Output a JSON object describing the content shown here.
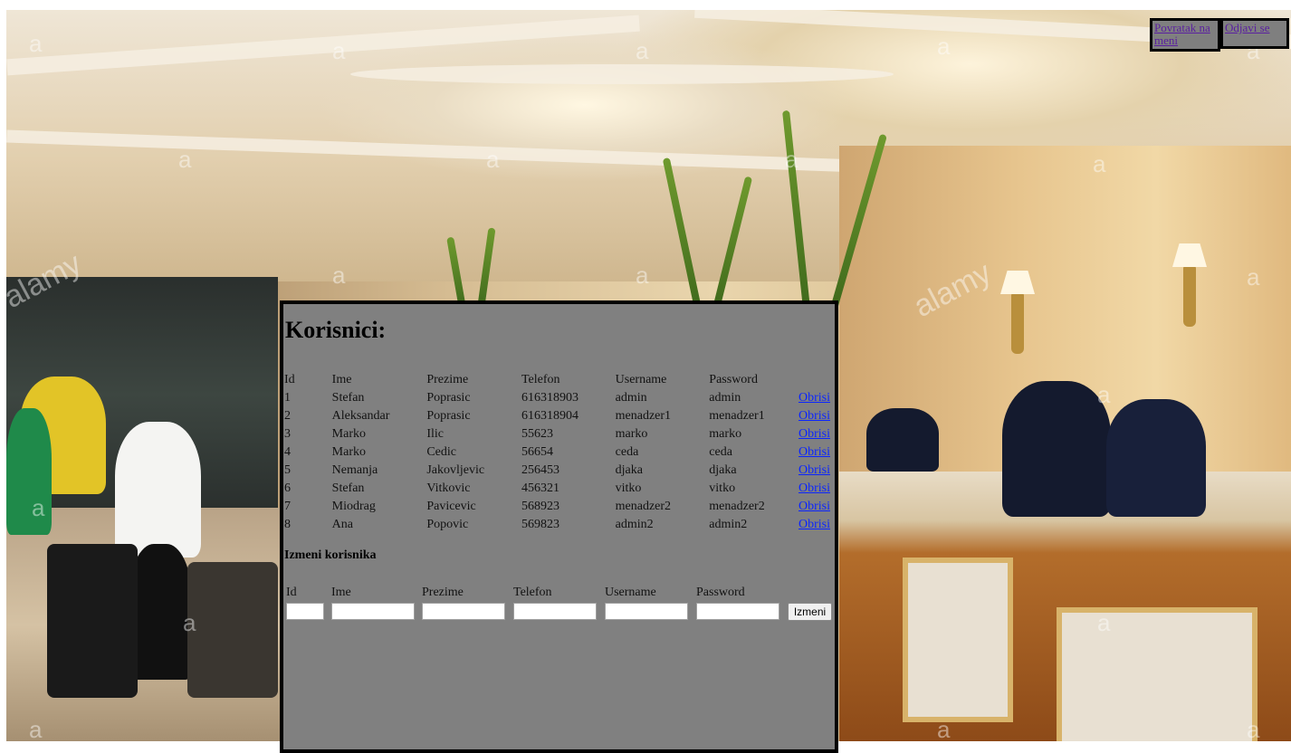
{
  "nav": {
    "back_label": "Povratak na meni",
    "logout_label": "Odjavi se"
  },
  "background": {
    "watermark": "a",
    "watermark_brand": "alamy"
  },
  "page": {
    "title": "Korisnici:"
  },
  "table": {
    "headers": [
      "Id",
      "Ime",
      "Prezime",
      "Telefon",
      "Username",
      "Password"
    ],
    "delete_label": "Obrisi",
    "rows": [
      [
        "1",
        "Stefan",
        "Poprasic",
        "616318903",
        "admin",
        "admin"
      ],
      [
        "2",
        "Aleksandar",
        "Poprasic",
        "616318904",
        "menadzer1",
        "menadzer1"
      ],
      [
        "3",
        "Marko",
        "Ilic",
        "55623",
        "marko",
        "marko"
      ],
      [
        "4",
        "Marko",
        "Cedic",
        "56654",
        "ceda",
        "ceda"
      ],
      [
        "5",
        "Nemanja",
        "Jakovljevic",
        "256453",
        "djaka",
        "djaka"
      ],
      [
        "6",
        "Stefan",
        "Vitkovic",
        "456321",
        "vitko",
        "vitko"
      ],
      [
        "7",
        "Miodrag",
        "Pavicevic",
        "568923",
        "menadzer2",
        "menadzer2"
      ],
      [
        "8",
        "Ana",
        "Popovic",
        "569823",
        "admin2",
        "admin2"
      ]
    ]
  },
  "edit_form": {
    "title": "Izmeni korisnika",
    "labels": [
      "Id",
      "Ime",
      "Prezime",
      "Telefon",
      "Username",
      "Password"
    ],
    "values": [
      "",
      "",
      "",
      "",
      "",
      ""
    ],
    "submit_label": "Izmeni"
  }
}
